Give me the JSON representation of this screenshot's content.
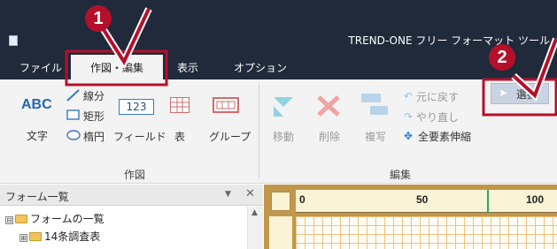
{
  "window": {
    "title": "TREND-ONE フリー フォーマット ツール"
  },
  "menu": {
    "items": [
      "ファイル",
      "作図・編集",
      "表示",
      "オプション"
    ],
    "active_index": 1
  },
  "ribbon": {
    "draw_group": {
      "label": "作図",
      "text_button": {
        "icon_text": "ABC",
        "label": "文字"
      },
      "line_button": "線分",
      "rect_button": "矩形",
      "ellipse_button": "楕円",
      "field_button": {
        "icon_text": "123",
        "label": "フィールド"
      },
      "table_button": "表",
      "group_button": "グループ"
    },
    "edit_group": {
      "label": "編集",
      "move_button": "移動",
      "delete_button": "削除",
      "copy_button": "複写",
      "undo_button": "元に戻す",
      "redo_button": "やり直し",
      "scale_all_button": "全要素伸縮",
      "select_button": "選択"
    }
  },
  "form_panel": {
    "title": "フォーム一覧",
    "tree": [
      {
        "label": "フォームの一覧",
        "expander": "⊟"
      },
      {
        "label": "14条調査表",
        "expander": "⊞"
      }
    ]
  },
  "ruler": {
    "ticks": [
      "0",
      "50",
      "100"
    ]
  },
  "callouts": [
    "1",
    "2"
  ],
  "colors": {
    "titlebar": "#202a3b",
    "highlight": "#b5102a",
    "accent": "#2465b6"
  }
}
